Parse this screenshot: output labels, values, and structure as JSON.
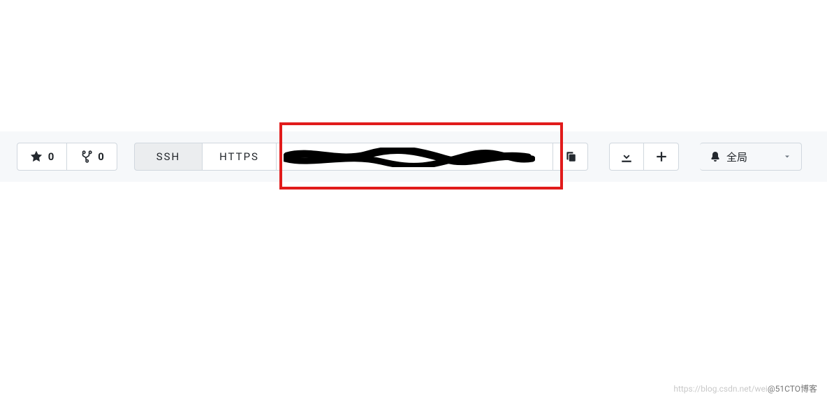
{
  "toolbar": {
    "star_count": "0",
    "fork_count": "0",
    "ssh_label": "SSH",
    "https_label": "HTTPS",
    "clone_url": "",
    "global_label": "全局"
  },
  "watermark": {
    "faint": "https://blog.csdn.net/wei",
    "bold": "@51CTO博客"
  }
}
